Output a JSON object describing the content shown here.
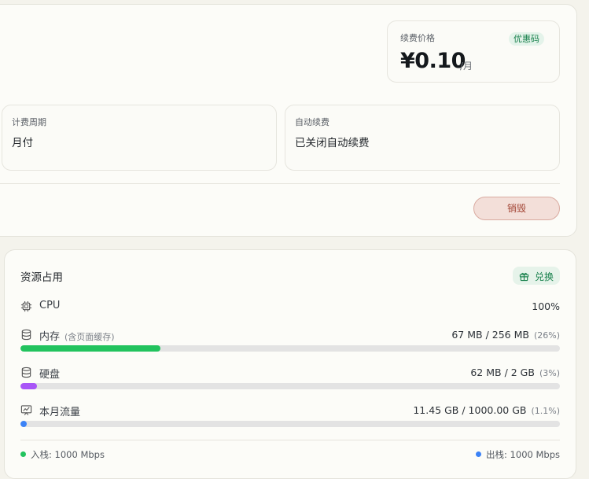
{
  "billing": {
    "price_label": "续费价格",
    "coupon_label": "优惠码",
    "price": "¥0.10",
    "price_unit": "/月",
    "period_label": "计费周期",
    "period_value": "月付",
    "auto_renew_label": "自动续费",
    "auto_renew_value": "已关闭自动续费",
    "destroy_label": "销毁"
  },
  "resources": {
    "title": "资源占用",
    "exchange_label": "兑换",
    "cpu": {
      "label": "CPU",
      "value": "100%"
    },
    "memory": {
      "label": "内存",
      "note": "(含页面缓存)",
      "value": "67 MB / 256 MB",
      "percent_text": "(26%)",
      "percent": 26,
      "color": "#22c35e"
    },
    "disk": {
      "label": "硬盘",
      "value": "62 MB / 2 GB",
      "percent_text": "(3%)",
      "percent": 3,
      "color": "#a855f7"
    },
    "traffic": {
      "label": "本月流量",
      "value": "11.45 GB / 1000.00 GB",
      "percent_text": "(1.1%)",
      "percent": 1.1,
      "color": "#3b82f6"
    },
    "inbound": "入栈: 1000 Mbps",
    "outbound": "出栈: 1000 Mbps",
    "inbound_color": "#22c35e",
    "outbound_color": "#3b82f6"
  }
}
